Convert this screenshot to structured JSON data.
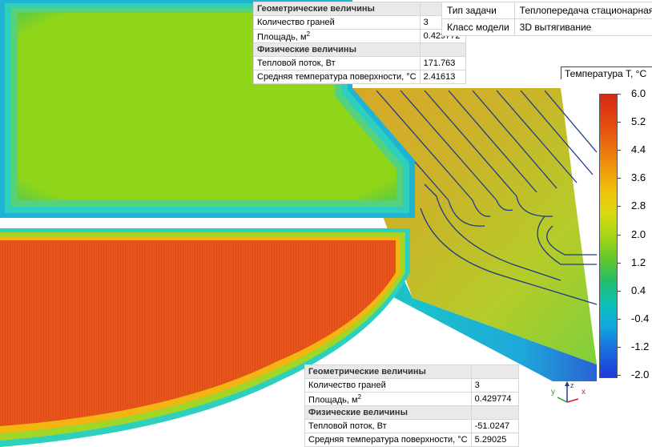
{
  "top_properties": {
    "geom_header": "Геометрические величины",
    "faces_label": "Количество граней",
    "faces_value": "3",
    "area_label": "Площадь, м",
    "area_sup": "2",
    "area_value": "0.429772",
    "phys_header": "Физические величины",
    "flux_label": "Тепловой поток, Вт",
    "flux_value": "171.763",
    "temp_label": "Средняя температура поверхности, °С",
    "temp_value": "2.41613"
  },
  "task_info": {
    "task_type_label": "Тип задачи",
    "task_type_value": "Теплопередача стационарная",
    "model_class_label": "Класс модели",
    "model_class_value": "3D вытягивание"
  },
  "bottom_properties": {
    "geom_header": "Геометрические величины",
    "faces_label": "Количество граней",
    "faces_value": "3",
    "area_label": "Площадь, м",
    "area_sup": "2",
    "area_value": "0.429774",
    "phys_header": "Физические величины",
    "flux_label": "Тепловой поток, Вт",
    "flux_value": "-51.0247",
    "temp_label": "Средняя температура поверхности, °С",
    "temp_value": "5.29025"
  },
  "legend": {
    "title": "Температура T, °С",
    "ticks": [
      "6.0",
      "5.2",
      "4.4",
      "3.6",
      "2.8",
      "2.0",
      "1.2",
      "0.4",
      "-0.4",
      "-1.2",
      "-2.0"
    ],
    "colors": {
      "max": "#d62a13",
      "mid": "#a6d517",
      "min": "#1e3ad8"
    }
  },
  "axes": {
    "x": "x",
    "y": "y",
    "z": "z"
  }
}
